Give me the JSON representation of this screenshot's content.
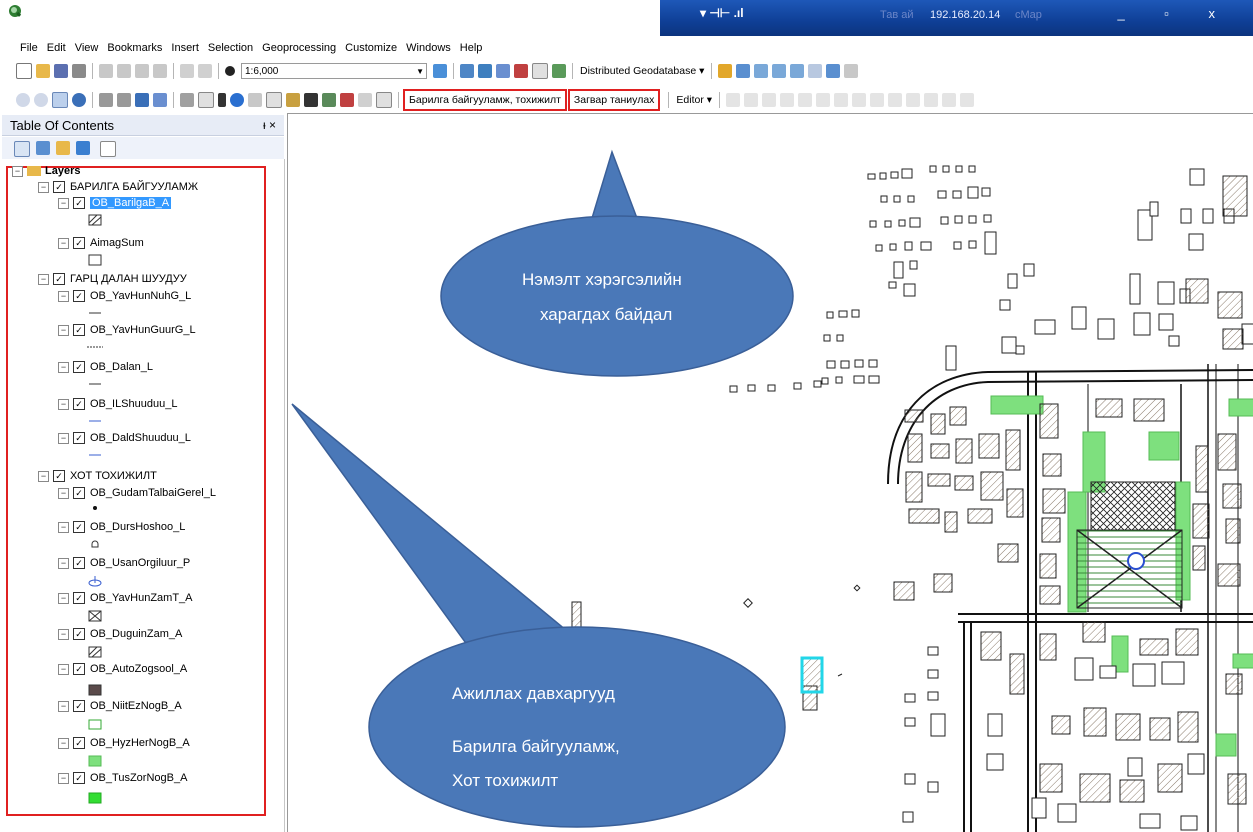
{
  "window": {
    "title_ghost": "Тав ай",
    "title_ip": "192.168.20.14",
    "title_suffix": "cMap",
    "controls": "_ ▫ x"
  },
  "menu": [
    "File",
    "Edit",
    "View",
    "Bookmarks",
    "Insert",
    "Selection",
    "Geoprocessing",
    "Customize",
    "Windows",
    "Help"
  ],
  "toolbar": {
    "scale": "1:6,000",
    "distributed_gdb": "Distributed Geodatabase ▾",
    "editor": "Editor ▾",
    "custom_toolbar_1": "Барилга байгууламж, тохижилт",
    "custom_toolbar_2": "Загвар таниулах"
  },
  "toc": {
    "title": "Table Of Contents",
    "pin": "ᵻ ×",
    "root": "Layers",
    "groups": [
      {
        "name": "БАРИЛГА БАЙГУУЛАМЖ",
        "layers": [
          "OB_BarilgaB_A",
          "AimagSum"
        ]
      },
      {
        "name": "ГАРЦ ДАЛАН ШУУДУУ",
        "layers": [
          "OB_YavHunNuhG_L",
          "OB_YavHunGuurG_L",
          "OB_Dalan_L",
          "OB_ILShuuduu_L",
          "OB_DaldShuuduu_L"
        ]
      },
      {
        "name": "ХОТ ТОХИЖИЛТ",
        "layers": [
          "OB_GudamTalbaiGerel_L",
          "OB_DursHoshoo_L",
          "OB_UsanOrgiluur_P",
          "OB_YavHunZamT_A",
          "OB_DuguinZam_A",
          "OB_AutoZogsool_A",
          "OB_NiitEzNogB_A",
          "OB_HyzHerNogB_A",
          "OB_TusZorNogB_A"
        ]
      }
    ]
  },
  "callouts": {
    "top_line1": "Нэмэлт хэрэгсэлийн",
    "top_line2": "харагдах байдал",
    "bottom_line1": "Ажиллах давхаргууд",
    "bottom_line2": "Барилга байгууламж,",
    "bottom_line3": "Хот тохижилт"
  },
  "colors": {
    "accent_red": "#e02020",
    "callout_fill": "#4a78b8",
    "title_blue": "#1a4ea8",
    "green_area": "#7ee07e"
  }
}
